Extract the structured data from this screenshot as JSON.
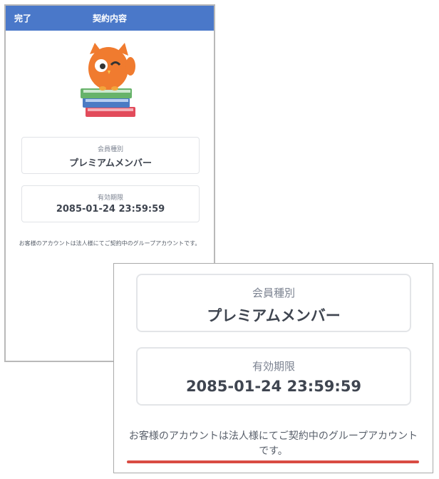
{
  "phone": {
    "nav": {
      "done": "完了",
      "title": "契約内容"
    },
    "cards": [
      {
        "label": "会員種別",
        "value": "プレミアムメンバー"
      },
      {
        "label": "有効期限",
        "value": "2085-01-24 23:59:59"
      }
    ],
    "notice": "お客様のアカウントは法人様にてご契約中のグループアカウントです。"
  },
  "zoom": {
    "cards": [
      {
        "label": "会員種別",
        "value": "プレミアムメンバー"
      },
      {
        "label": "有効期限",
        "value": "2085-01-24 23:59:59"
      }
    ],
    "notice": "お客様のアカウントは法人様にてご契約中のグループアカウントです。",
    "highlight_color": "#d94b43"
  },
  "colors": {
    "nav_blue": "#4a78c9",
    "mascot_orange": "#f07b2f"
  },
  "icons": {
    "mascot": "owl-on-books-illustration"
  }
}
